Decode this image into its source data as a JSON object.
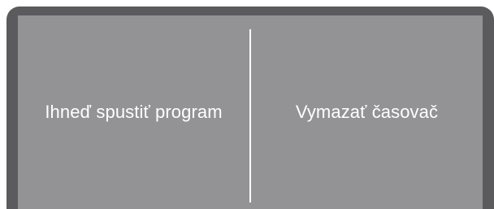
{
  "screen": {
    "colors": {
      "frame": "#5b5b5d",
      "screen_background": "#939395",
      "text": "#ffffff",
      "divider": "#ffffff"
    },
    "buttons": [
      {
        "label": "Ihneď spustiť program"
      },
      {
        "label": "Vymazať časovač"
      }
    ]
  }
}
